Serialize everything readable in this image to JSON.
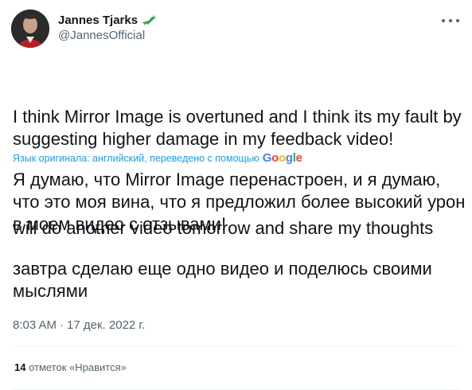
{
  "author": {
    "display_name": "Jannes Tjarks",
    "handle": "@JannesOfficial",
    "badge_icon": "lizard-icon",
    "avatar_icon": "avatar"
  },
  "tweet": {
    "paragraphs": [
      "I think Mirror Image is overtuned and I think its my fault by suggesting higher damage in my feedback video!",
      "will do another video tomorrow and share my thoughts"
    ]
  },
  "translation": {
    "note": "Язык оригинала: английский, переведено с помощью",
    "provider": "Google",
    "paragraphs": [
      "Я думаю, что Mirror Image перенастроен, и я думаю, что это моя вина, что я предложил более высокий урон в моем видео с отзывами!",
      "завтра сделаю еще одно видео и поделюсь своими мыслями"
    ]
  },
  "meta": {
    "time": "8:03 AM",
    "separator": "·",
    "date": "17 дек. 2022 г."
  },
  "engagement": {
    "likes_count": "14",
    "likes_label": "отметок «Нравится»"
  },
  "colors": {
    "text": "#0f1419",
    "secondary": "#536471",
    "accent": "#1d9bf0",
    "badge": "#2f9e44"
  }
}
